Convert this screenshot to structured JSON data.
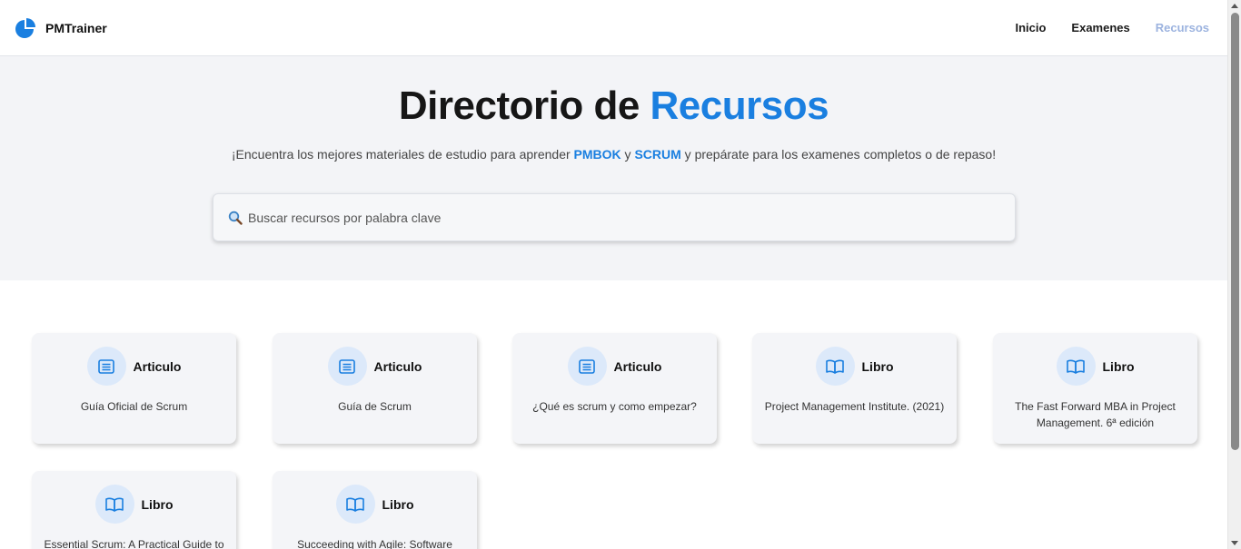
{
  "brand": {
    "name": "PMTrainer",
    "icon": "pie-chart-icon",
    "color": "#1a7fe0"
  },
  "nav": {
    "items": [
      {
        "label": "Inicio",
        "active": false
      },
      {
        "label": "Examenes",
        "active": false
      },
      {
        "label": "Recursos",
        "active": true
      }
    ]
  },
  "hero": {
    "title_part1": "Directorio de ",
    "title_part2": "Recursos",
    "subtitle_part1": "¡Encuentra los mejores materiales de estudio para aprender ",
    "subtitle_hl1": "PMBOK",
    "subtitle_part2": " y ",
    "subtitle_hl2": "SCRUM",
    "subtitle_part3": " y prepárate para los examenes completos o de repaso!"
  },
  "search": {
    "placeholder": "Buscar recursos por palabra clave",
    "value": "",
    "icon": "magnifier-icon"
  },
  "resources": [
    {
      "type": "Articulo",
      "icon": "article-icon",
      "title": "Guía Oficial de Scrum"
    },
    {
      "type": "Articulo",
      "icon": "article-icon",
      "title": "Guía de Scrum"
    },
    {
      "type": "Articulo",
      "icon": "article-icon",
      "title": "¿Qué es scrum y como empezar?"
    },
    {
      "type": "Libro",
      "icon": "book-icon",
      "title": "Project Management Institute. (2021)"
    },
    {
      "type": "Libro",
      "icon": "book-icon",
      "title": "The Fast Forward MBA in Project Management. 6ª edición"
    },
    {
      "type": "Libro",
      "icon": "book-icon",
      "title": "Essential Scrum: A Practical Guide to"
    },
    {
      "type": "Libro",
      "icon": "book-icon",
      "title": "Succeeding with Agile: Software"
    }
  ],
  "colors": {
    "accent": "#1a7fe0",
    "nav_active": "#9cb3df",
    "hero_bg": "#f3f4f7",
    "card_bg": "#f4f5f8",
    "icon_bg": "#dce9fa"
  }
}
